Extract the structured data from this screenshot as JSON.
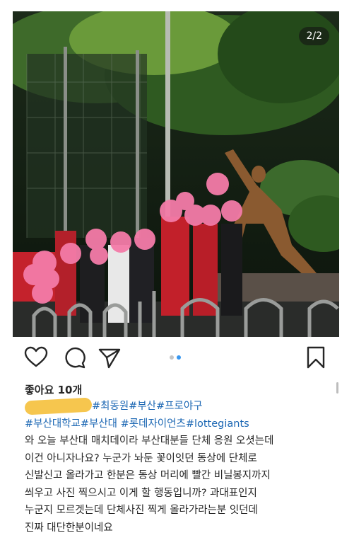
{
  "photo": {
    "counter": "2/2"
  },
  "actions": {
    "like_icon": "heart-icon",
    "comment_icon": "comment-icon",
    "share_icon": "send-icon",
    "save_icon": "bookmark-icon",
    "carousel_active_index": 2,
    "carousel_total": 2
  },
  "post": {
    "likes": "좋아요 10개",
    "hashtags_line1": "#최동원#부산#프로야구",
    "hashtags_line2": "#부산대학교#부산대 #롯데자이언츠#lottegiants",
    "body_lines": [
      "와 오늘 부산대 매치데이라 부산대분들 단체 응원 오셧는데",
      "이건 아니자나요? 누군가 놔둔 꽃이잇던 동상에 단체로",
      "신발신고 올라가고 한분은 동상 머리에 빨간 비닐봉지까지",
      "씌우고 사진 찍으시고 이게  할 행동입니까? 과대표인지",
      "누군지 모르겟는데 단체사진 찍게  올라가라는분 잇던데",
      "진짜 대단한분이네요"
    ]
  },
  "colors": {
    "hashtag": "#1a66b3",
    "redaction": "#f6c64e",
    "blur_faces": "#f47ba8"
  }
}
